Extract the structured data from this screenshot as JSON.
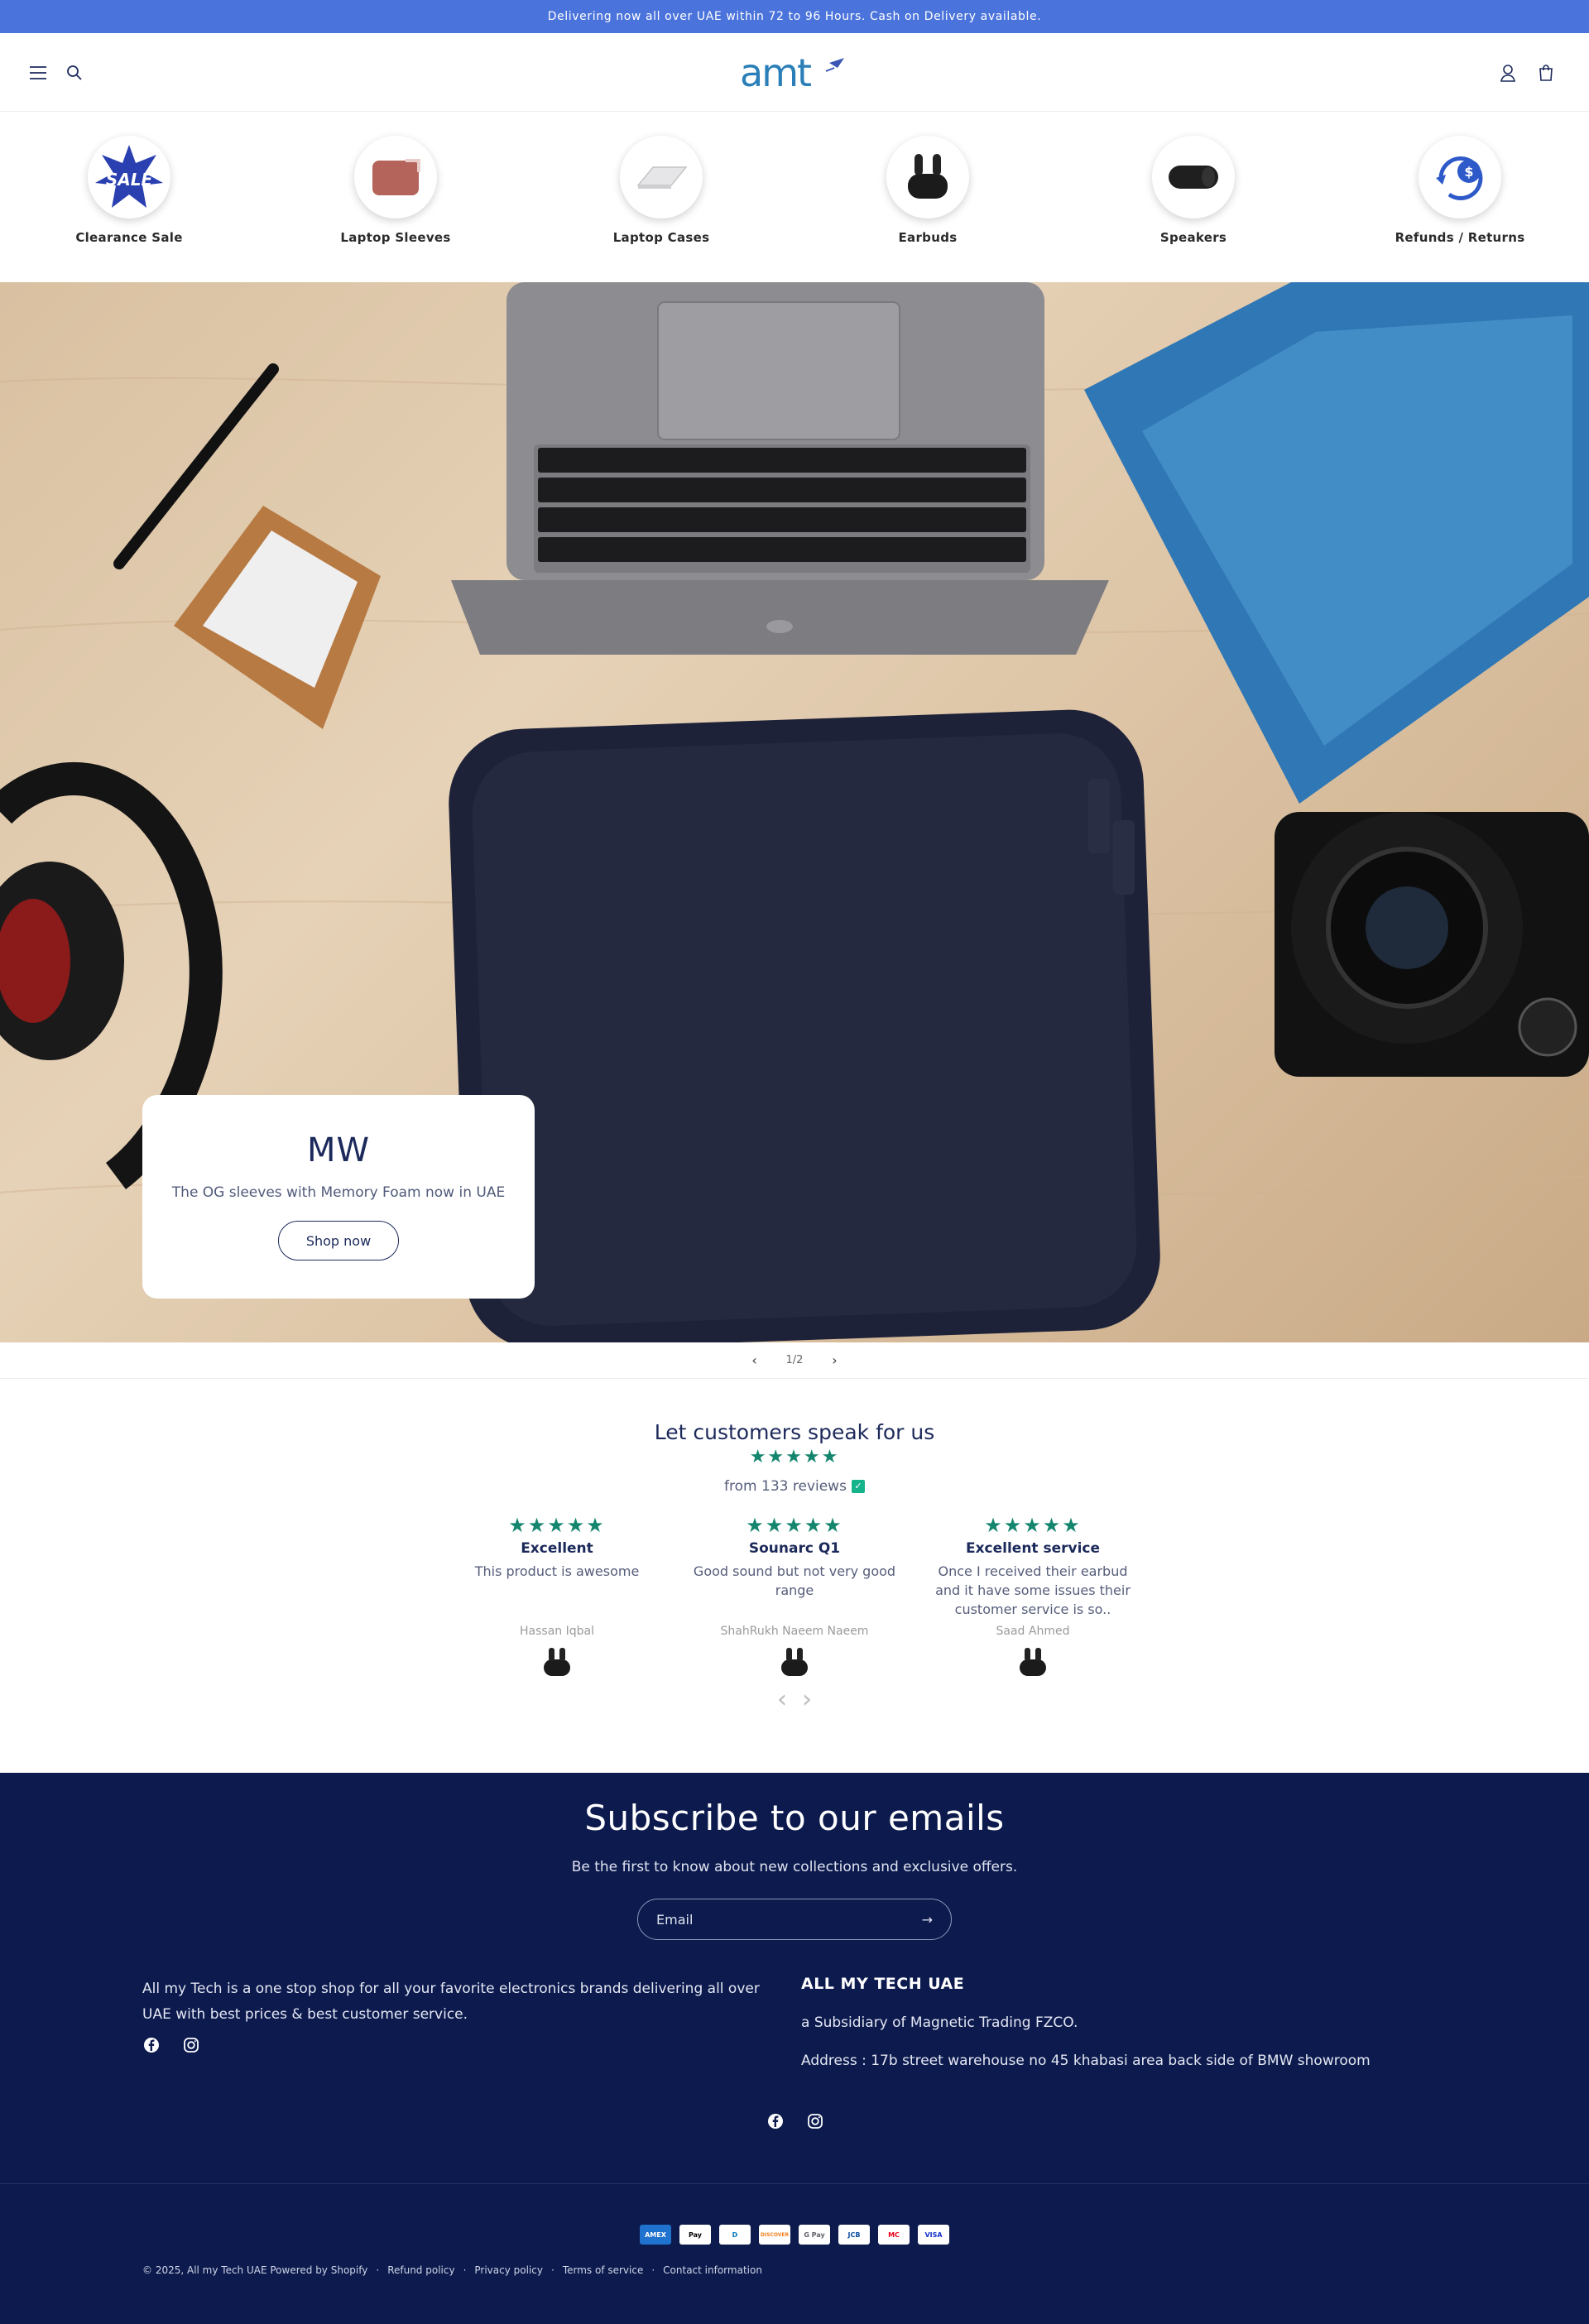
{
  "announcement": "Delivering now all over UAE within 72 to 96 Hours. Cash on Delivery available.",
  "header": {
    "logo_text": "amt",
    "icons": [
      "menu-icon",
      "search-icon",
      "account-icon",
      "cart-icon"
    ]
  },
  "categories": [
    {
      "label": "Clearance Sale",
      "icon": "sale-badge"
    },
    {
      "label": "Laptop Sleeves",
      "icon": "laptop-sleeve"
    },
    {
      "label": "Laptop Cases",
      "icon": "laptop-case"
    },
    {
      "label": "Earbuds",
      "icon": "earbuds"
    },
    {
      "label": "Speakers",
      "icon": "speaker"
    },
    {
      "label": "Refunds / Returns",
      "icon": "refund"
    }
  ],
  "hero": {
    "title": "MW",
    "subtitle": "The OG sleeves with Memory Foam now in UAE",
    "button": "Shop now",
    "slide_counter": "1/2"
  },
  "reviews": {
    "title": "Let customers speak for us",
    "stars": "★★★★★",
    "count_text": "from 133 reviews",
    "items": [
      {
        "stars": "★★★★★",
        "heading": "Excellent",
        "body": "This product is awesome",
        "author": "Hassan Iqbal"
      },
      {
        "stars": "★★★★★",
        "heading": "Sounarc Q1",
        "body": "Good sound but not very good range",
        "author": "ShahRukh Naeem Naeem"
      },
      {
        "stars": "★★★★★",
        "heading": "Excellent service",
        "body": "Once I received their earbud and it have some issues their customer service is so..",
        "author": "Saad Ahmed"
      }
    ]
  },
  "newsletter": {
    "title": "Subscribe to our emails",
    "subtitle": "Be the first to know about new collections and exclusive offers.",
    "placeholder": "Email"
  },
  "footer": {
    "about": "All my Tech is a one stop shop for all your favorite electronics brands delivering all over UAE with best prices & best customer service.",
    "col_title": "ALL MY TECH UAE",
    "col_line1": "a Subsidiary of Magnetic Trading FZCO.",
    "col_line2": "Address : 17b street warehouse no 45 khabasi area back side of BMW showroom",
    "payments": [
      "AMEX",
      "Pay",
      "D",
      "DISCOVER",
      "G Pay",
      "JCB",
      "MC",
      "VISA"
    ],
    "copyright": "© 2025, All my Tech UAE Powered by Shopify",
    "links": [
      "Refund policy",
      "Privacy policy",
      "Terms of service",
      "Contact information"
    ]
  },
  "colors": {
    "announcement_bg": "#4a73db",
    "brand_navy": "#0c1a4e",
    "star_green": "#15866e"
  }
}
